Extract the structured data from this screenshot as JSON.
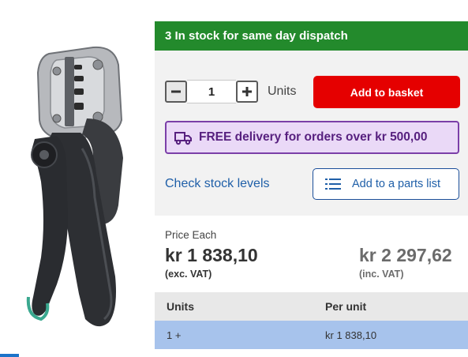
{
  "product": {
    "image_icon": "crimping-pliers-image"
  },
  "stock": {
    "text": "3 In stock for same day dispatch",
    "color": "#238a2c"
  },
  "purchase": {
    "minus_icon": "minus-icon",
    "quantity": "1",
    "plus_icon": "plus-icon",
    "units_label": "Units",
    "add_to_basket": "Add to basket",
    "accent": "#e50000"
  },
  "delivery": {
    "icon": "delivery-van-icon",
    "text": "FREE delivery for orders over kr 500,00"
  },
  "stock_link": "Check stock levels",
  "parts_list": {
    "icon": "list-icon",
    "label": "Add to a parts list"
  },
  "pricing": {
    "each_label": "Price Each",
    "exc_vat_price": "kr 1 838,10",
    "exc_vat_note": "(exc. VAT)",
    "inc_vat_price": "kr 2 297,62",
    "inc_vat_note": "(inc. VAT)"
  },
  "tiers": {
    "headers": [
      "Units",
      "Per unit"
    ],
    "rows": [
      {
        "units": "1 +",
        "per_unit": "kr 1 838,10"
      }
    ]
  }
}
